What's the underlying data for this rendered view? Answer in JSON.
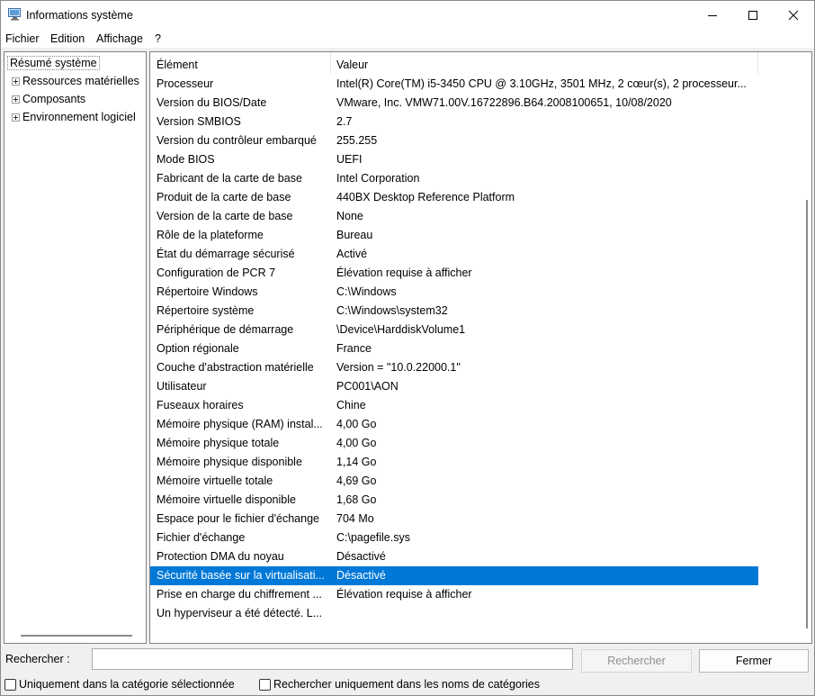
{
  "window": {
    "title": "Informations système"
  },
  "menu": [
    "Fichier",
    "Edition",
    "Affichage",
    "?"
  ],
  "tree": {
    "root": "Résumé système",
    "items": [
      {
        "label": "Ressources matérielles"
      },
      {
        "label": "Composants"
      },
      {
        "label": "Environnement logiciel"
      }
    ]
  },
  "list": {
    "headers": {
      "element": "Élément",
      "value": "Valeur"
    },
    "rows": [
      {
        "element": "Processeur",
        "value": "Intel(R) Core(TM) i5-3450 CPU @ 3.10GHz, 3501 MHz, 2 cœur(s), 2 processeur..."
      },
      {
        "element": "Version du BIOS/Date",
        "value": "VMware, Inc. VMW71.00V.16722896.B64.2008100651, 10/08/2020"
      },
      {
        "element": "Version SMBIOS",
        "value": "2.7"
      },
      {
        "element": "Version du contrôleur embarqué",
        "value": "255.255"
      },
      {
        "element": "Mode BIOS",
        "value": "UEFI"
      },
      {
        "element": "Fabricant de la carte de base",
        "value": "Intel Corporation"
      },
      {
        "element": "Produit de la carte de base",
        "value": "440BX Desktop Reference Platform"
      },
      {
        "element": "Version de la carte de base",
        "value": "None"
      },
      {
        "element": "Rôle de la plateforme",
        "value": "Bureau"
      },
      {
        "element": "État du démarrage sécurisé",
        "value": "Activé"
      },
      {
        "element": "Configuration de PCR 7",
        "value": "Élévation requise à afficher"
      },
      {
        "element": "Répertoire Windows",
        "value": "C:\\Windows"
      },
      {
        "element": "Répertoire système",
        "value": "C:\\Windows\\system32"
      },
      {
        "element": "Périphérique de démarrage",
        "value": "\\Device\\HarddiskVolume1"
      },
      {
        "element": "Option régionale",
        "value": "France"
      },
      {
        "element": "Couche d'abstraction matérielle",
        "value": "Version = \"10.0.22000.1\""
      },
      {
        "element": "Utilisateur",
        "value": "PC001\\AON"
      },
      {
        "element": "Fuseaux horaires",
        "value": "Chine"
      },
      {
        "element": "Mémoire physique (RAM) instal...",
        "value": "4,00 Go"
      },
      {
        "element": "Mémoire physique totale",
        "value": "4,00 Go"
      },
      {
        "element": "Mémoire physique disponible",
        "value": "1,14 Go"
      },
      {
        "element": "Mémoire virtuelle totale",
        "value": "4,69 Go"
      },
      {
        "element": "Mémoire virtuelle disponible",
        "value": "1,68 Go"
      },
      {
        "element": "Espace pour le fichier d'échange",
        "value": "704 Mo"
      },
      {
        "element": "Fichier d'échange",
        "value": "C:\\pagefile.sys"
      },
      {
        "element": "Protection DMA du noyau",
        "value": "Désactivé"
      },
      {
        "element": "Sécurité basée sur la virtualisati...",
        "value": "Désactivé",
        "selected": true
      },
      {
        "element": "Prise en charge du chiffrement ...",
        "value": "Élévation requise à afficher"
      },
      {
        "element": "Un hyperviseur a été détecté. L...",
        "value": ""
      }
    ]
  },
  "search": {
    "label": "Rechercher :",
    "value": "",
    "search_button": "Rechercher",
    "close_button": "Fermer",
    "option_selected_category": "Uniquement dans la catégorie sélectionnée",
    "option_category_names": "Rechercher uniquement dans les noms de catégories"
  },
  "colors": {
    "selection": "#0078d7",
    "background": "#f0f0f0"
  }
}
